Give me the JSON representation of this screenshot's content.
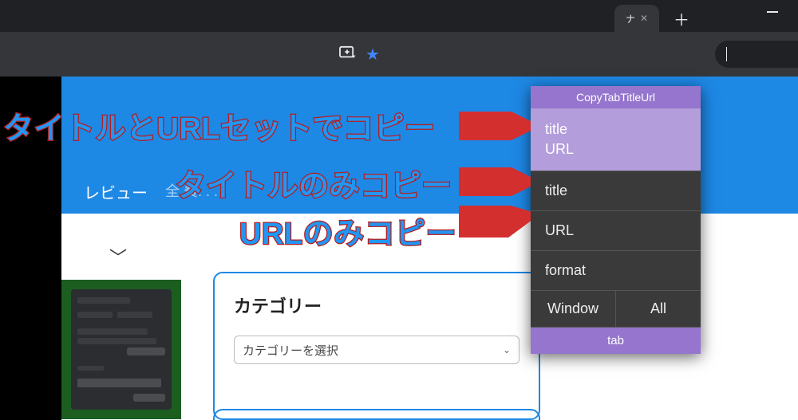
{
  "browser": {
    "tab_label": "ナ",
    "omnibox_value": ""
  },
  "page": {
    "nav_item": "レビュー",
    "nav_dots": "全.費.  . . .",
    "chevron": "﹀"
  },
  "card": {
    "title": "カテゴリー",
    "select_placeholder": "カテゴリーを選択"
  },
  "popup": {
    "header": "CopyTabTitleUrl",
    "item_title_url_line1": "title",
    "item_title_url_line2": "URL",
    "item_title": "title",
    "item_url": "URL",
    "item_format": "format",
    "btn_window": "Window",
    "btn_all": "All",
    "footer": "tab"
  },
  "annotations": {
    "a1": "タイトルとURLセットでコピー",
    "a2": "タイトルのみコピー",
    "a3": "URLのみコピー"
  }
}
